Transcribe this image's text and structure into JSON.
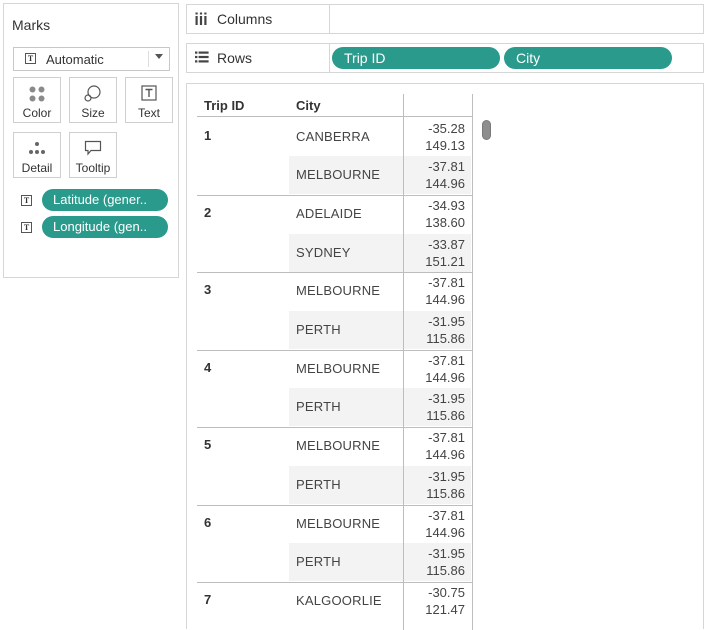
{
  "marks": {
    "title": "Marks",
    "mark_type": "Automatic",
    "buttons": [
      {
        "label": "Color",
        "icon": "color-dots-icon"
      },
      {
        "label": "Size",
        "icon": "size-icon"
      },
      {
        "label": "Text",
        "icon": "text-icon"
      },
      {
        "label": "Detail",
        "icon": "detail-icon"
      },
      {
        "label": "Tooltip",
        "icon": "tooltip-icon"
      }
    ],
    "fields": [
      {
        "label": "Latitude (gener.."
      },
      {
        "label": "Longitude (gen.."
      }
    ]
  },
  "shelves": {
    "columns": {
      "label": "Columns"
    },
    "rows": {
      "label": "Rows",
      "pills": [
        "Trip ID",
        "City"
      ]
    }
  },
  "table": {
    "headers": {
      "trip_id": "Trip ID",
      "city": "City"
    },
    "trips": [
      {
        "id": "1",
        "stops": [
          {
            "city": "CANBERRA",
            "lat": "-35.28",
            "lon": "149.13"
          },
          {
            "city": "MELBOURNE",
            "lat": "-37.81",
            "lon": "144.96"
          }
        ]
      },
      {
        "id": "2",
        "stops": [
          {
            "city": "ADELAIDE",
            "lat": "-34.93",
            "lon": "138.60"
          },
          {
            "city": "SYDNEY",
            "lat": "-33.87",
            "lon": "151.21"
          }
        ]
      },
      {
        "id": "3",
        "stops": [
          {
            "city": "MELBOURNE",
            "lat": "-37.81",
            "lon": "144.96"
          },
          {
            "city": "PERTH",
            "lat": "-31.95",
            "lon": "115.86"
          }
        ]
      },
      {
        "id": "4",
        "stops": [
          {
            "city": "MELBOURNE",
            "lat": "-37.81",
            "lon": "144.96"
          },
          {
            "city": "PERTH",
            "lat": "-31.95",
            "lon": "115.86"
          }
        ]
      },
      {
        "id": "5",
        "stops": [
          {
            "city": "MELBOURNE",
            "lat": "-37.81",
            "lon": "144.96"
          },
          {
            "city": "PERTH",
            "lat": "-31.95",
            "lon": "115.86"
          }
        ]
      },
      {
        "id": "6",
        "stops": [
          {
            "city": "MELBOURNE",
            "lat": "-37.81",
            "lon": "144.96"
          },
          {
            "city": "PERTH",
            "lat": "-31.95",
            "lon": "115.86"
          }
        ]
      },
      {
        "id": "7",
        "stops": [
          {
            "city": "KALGOORLIE",
            "lat": "-30.75",
            "lon": "121.47"
          }
        ]
      }
    ]
  },
  "colors": {
    "pill": "#2a9a8c",
    "shaded_cell": "#f3f3f3",
    "grid_line": "#bdbdbd"
  }
}
